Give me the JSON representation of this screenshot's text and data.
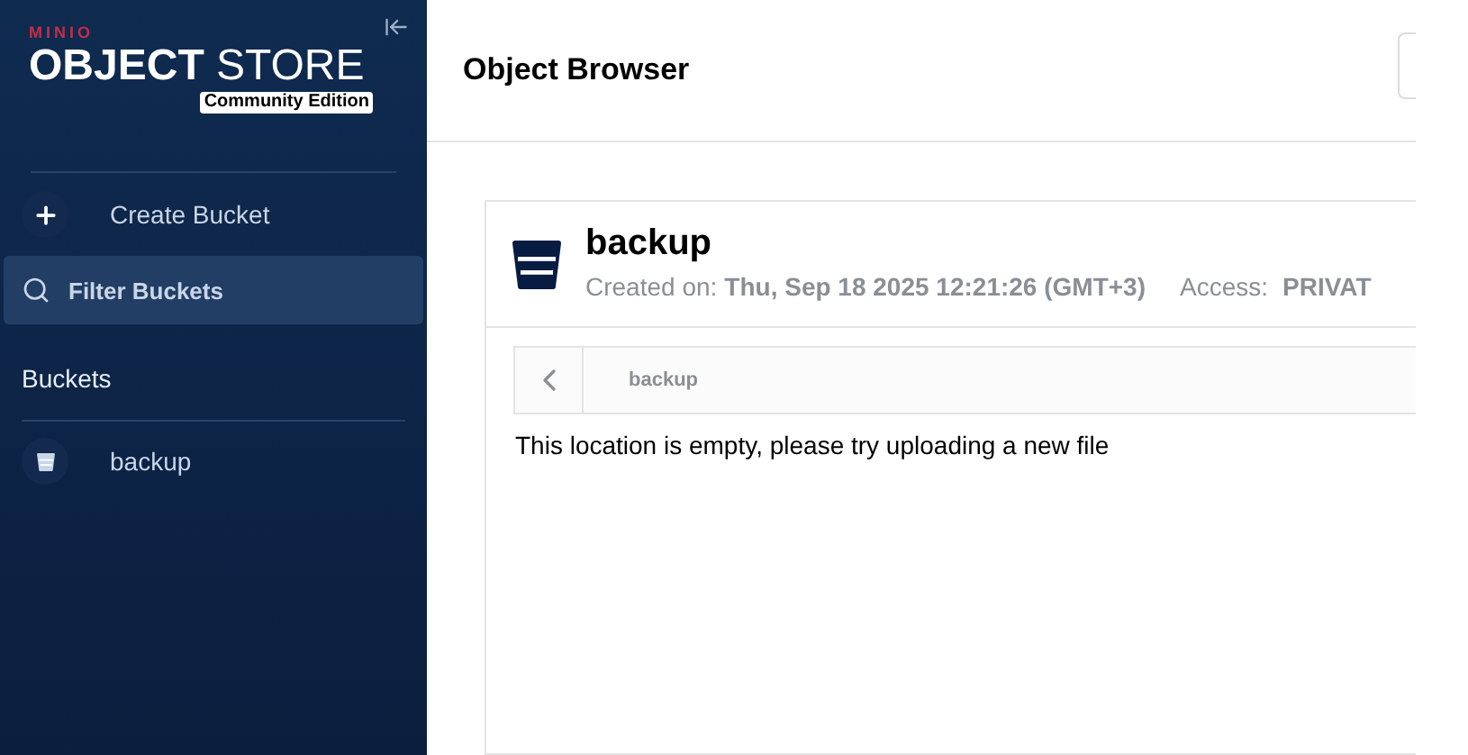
{
  "sidebar": {
    "brand": "MINIO",
    "product": {
      "bold": "OBJECT",
      "light": "STORE"
    },
    "edition": "Community Edition",
    "create_button": "Create Bucket",
    "filter": {
      "placeholder": "Filter Buckets"
    },
    "section_title": "Buckets",
    "buckets": [
      {
        "name": "backup",
        "selected": false
      }
    ]
  },
  "header": {
    "title": "Object Browser"
  },
  "bucket": {
    "name": "backup",
    "created_label": "Created on:",
    "created_value": "Thu, Sep 18 2025 12:21:26 (GMT+3)",
    "access_label": "Access:",
    "access_value": "PRIVAT"
  },
  "breadcrumb": {
    "path": "backup"
  },
  "empty_message": "This location is empty, please try uploading a new file"
}
